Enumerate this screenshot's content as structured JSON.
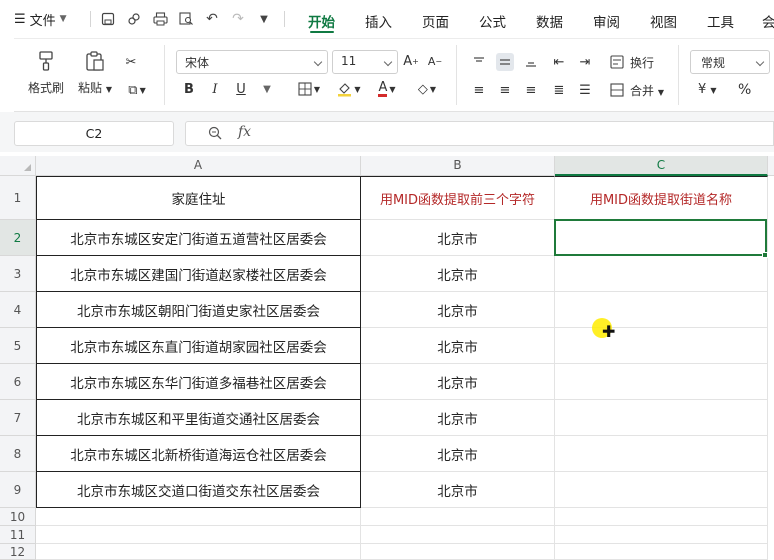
{
  "menubar": {
    "file_label": "文件",
    "tabs": [
      {
        "label": "开始",
        "active": true
      },
      {
        "label": "插入",
        "active": false
      },
      {
        "label": "页面",
        "active": false
      },
      {
        "label": "公式",
        "active": false
      },
      {
        "label": "数据",
        "active": false
      },
      {
        "label": "审阅",
        "active": false
      },
      {
        "label": "视图",
        "active": false
      },
      {
        "label": "工具",
        "active": false
      },
      {
        "label": "会",
        "active": false
      }
    ],
    "accent_color": "#107a43"
  },
  "ribbon": {
    "format_painter": "格式刷",
    "paste": "粘贴",
    "font_name": "宋体",
    "font_size": "11",
    "wrap_text": "换行",
    "merge": "合并",
    "number_format": "常规",
    "currency_symbol": "¥",
    "percent_symbol": "%"
  },
  "formula_bar": {
    "cell_ref": "C2",
    "fx_label": "fx",
    "formula": ""
  },
  "sheet": {
    "columns": [
      "A",
      "B",
      "C"
    ],
    "row_numbers": [
      "1",
      "2",
      "3",
      "4",
      "5",
      "6",
      "7",
      "8",
      "9",
      "10",
      "11",
      "12"
    ],
    "header_row": {
      "A": "家庭住址",
      "B": "用MID函数提取前三个字符",
      "C": "用MID函数提取街道名称"
    },
    "rows": [
      {
        "A": "北京市东城区安定门街道五道营社区居委会",
        "B": "北京市",
        "C": ""
      },
      {
        "A": "北京市东城区建国门街道赵家楼社区居委会",
        "B": "北京市",
        "C": ""
      },
      {
        "A": "北京市东城区朝阳门街道史家社区居委会",
        "B": "北京市",
        "C": ""
      },
      {
        "A": "北京市东城区东直门街道胡家园社区居委会",
        "B": "北京市",
        "C": ""
      },
      {
        "A": "北京市东城区东华门街道多福巷社区居委会",
        "B": "北京市",
        "C": ""
      },
      {
        "A": "北京市东城区和平里街道交通社区居委会",
        "B": "北京市",
        "C": ""
      },
      {
        "A": "北京市东城区北新桥街道海运仓社区居委会",
        "B": "北京市",
        "C": ""
      },
      {
        "A": "北京市东城区交道口街道交东社区居委会",
        "B": "北京市",
        "C": ""
      }
    ],
    "selected_cell": "C2",
    "header_text_color": "#b42828",
    "selection_color": "#1f7a3a"
  }
}
